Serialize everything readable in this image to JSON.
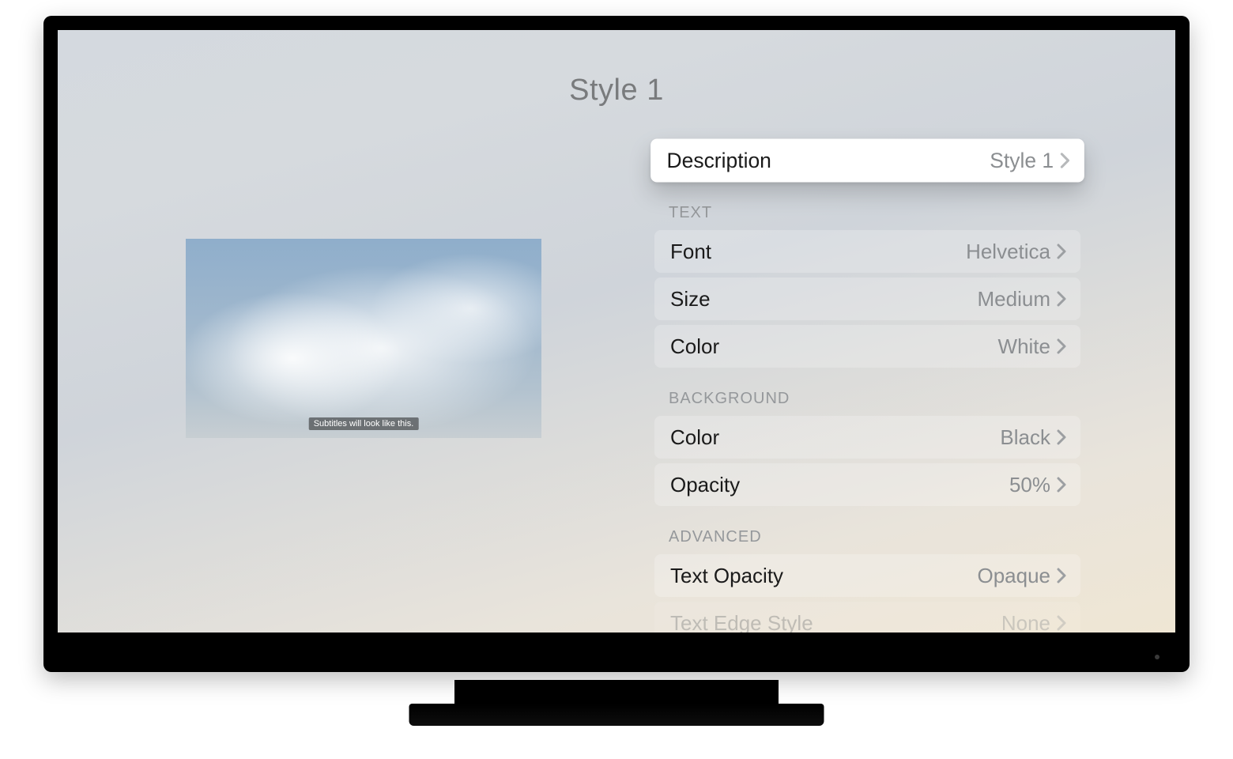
{
  "title": "Style 1",
  "preview": {
    "subtitle_text": "Subtitles will look like this."
  },
  "top_row": {
    "label": "Description",
    "value": "Style 1"
  },
  "sections": {
    "text": {
      "header": "TEXT",
      "font": {
        "label": "Font",
        "value": "Helvetica"
      },
      "size": {
        "label": "Size",
        "value": "Medium"
      },
      "color": {
        "label": "Color",
        "value": "White"
      }
    },
    "background": {
      "header": "BACKGROUND",
      "color": {
        "label": "Color",
        "value": "Black"
      },
      "opacity": {
        "label": "Opacity",
        "value": "50%"
      }
    },
    "advanced": {
      "header": "ADVANCED",
      "text_opacity": {
        "label": "Text Opacity",
        "value": "Opaque"
      },
      "text_edge_style": {
        "label": "Text Edge Style",
        "value": "None"
      }
    }
  }
}
